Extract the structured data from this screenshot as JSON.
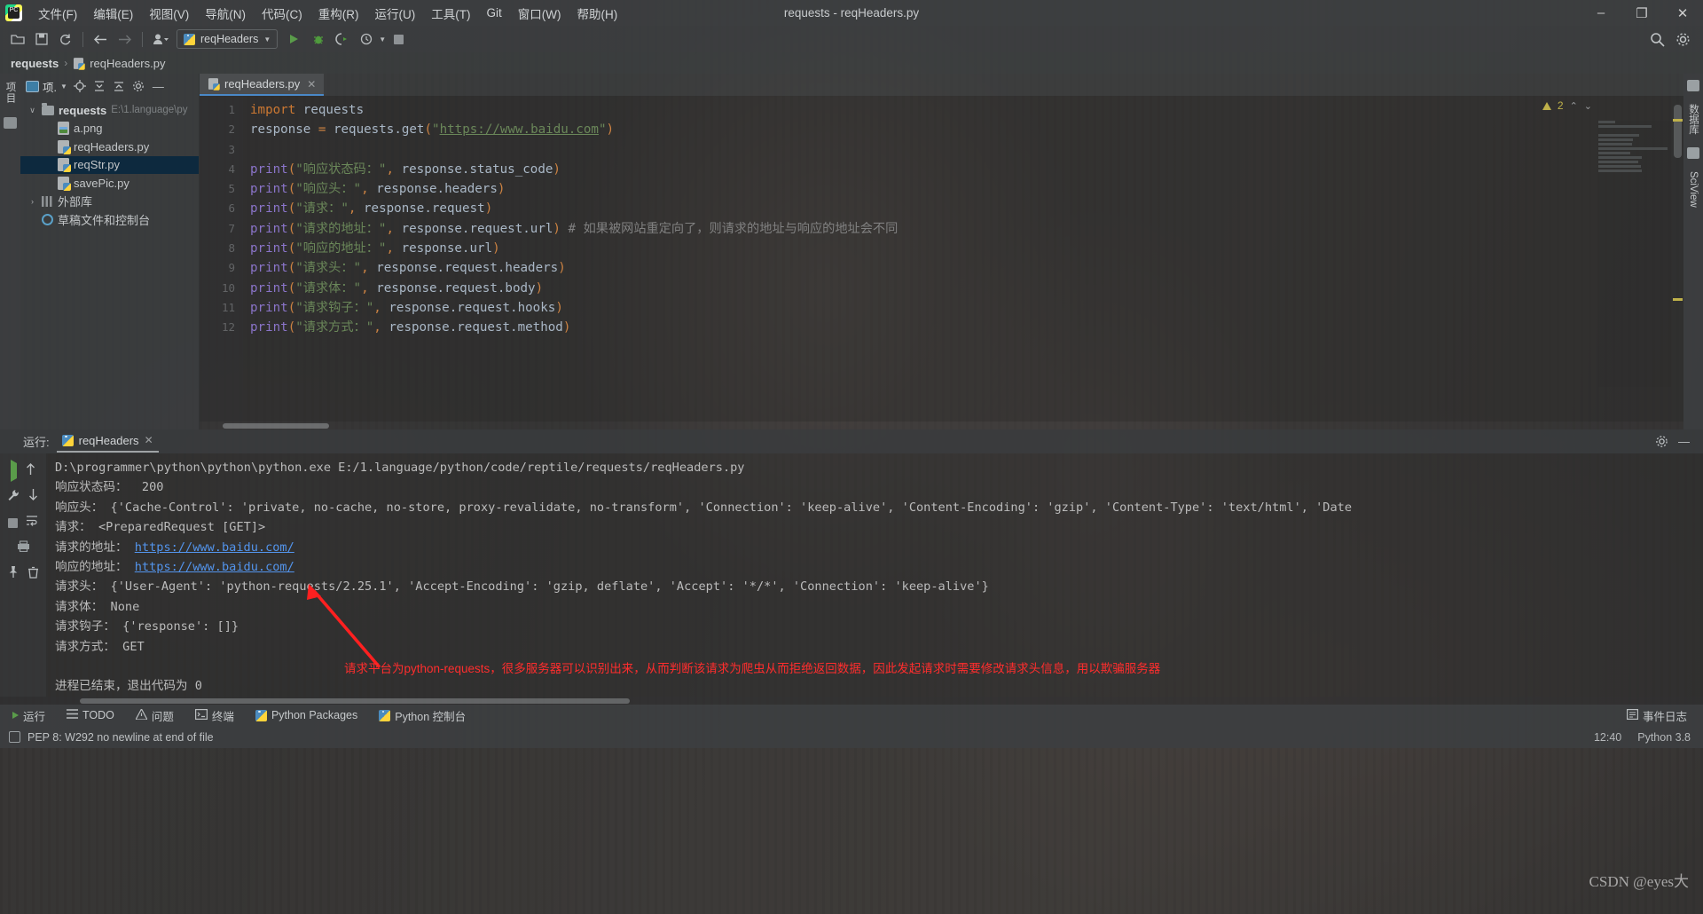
{
  "window": {
    "title": "requests - reqHeaders.py",
    "minimize": "–",
    "maximize": "❐",
    "close": "✕"
  },
  "menu": [
    {
      "label": "文件(F)"
    },
    {
      "label": "编辑(E)"
    },
    {
      "label": "视图(V)"
    },
    {
      "label": "导航(N)"
    },
    {
      "label": "代码(C)"
    },
    {
      "label": "重构(R)"
    },
    {
      "label": "运行(U)"
    },
    {
      "label": "工具(T)"
    },
    {
      "label": "Git"
    },
    {
      "label": "窗口(W)"
    },
    {
      "label": "帮助(H)"
    }
  ],
  "toolbar": {
    "open_icon": "open-folder-icon",
    "save_icon": "save-icon",
    "sync_icon": "sync-icon",
    "back_icon": "back-arrow-icon",
    "forward_icon": "forward-arrow-icon",
    "user_icon": "user-icon",
    "run_config": "reqHeaders",
    "run_icon": "run-icon",
    "debug_icon": "debug-icon",
    "coverage_icon": "run-coverage-icon",
    "profile_icon": "profile-icon",
    "stop_icon": "stop-icon",
    "search_icon": "search-icon",
    "settings_icon": "settings-gear-icon"
  },
  "breadcrumb": {
    "project": "requests",
    "separator": "›",
    "file": "reqHeaders.py"
  },
  "left_rail": {
    "project_label": "项目",
    "structure_icon": "structure-icon"
  },
  "project_panel": {
    "title": "项.",
    "locate_icon": "locate-target-icon",
    "expand_icon": "expand-all-icon",
    "collapse_icon": "collapse-all-icon",
    "settings_icon": "gear-icon",
    "hide_icon": "hide-icon",
    "tree": [
      {
        "label": "requests",
        "path": "E:\\1.language\\py",
        "kind": "folder",
        "depth": 0,
        "expanded": true,
        "selected": false
      },
      {
        "label": "a.png",
        "path": "",
        "kind": "image",
        "depth": 1,
        "expanded": false,
        "selected": false
      },
      {
        "label": "reqHeaders.py",
        "path": "",
        "kind": "python",
        "depth": 1,
        "expanded": false,
        "selected": false
      },
      {
        "label": "reqStr.py",
        "path": "",
        "kind": "python",
        "depth": 1,
        "expanded": false,
        "selected": true
      },
      {
        "label": "savePic.py",
        "path": "",
        "kind": "python",
        "depth": 1,
        "expanded": false,
        "selected": false
      },
      {
        "label": "外部库",
        "path": "",
        "kind": "library",
        "depth": 0,
        "expanded": false,
        "selected": false
      },
      {
        "label": "草稿文件和控制台",
        "path": "",
        "kind": "console",
        "depth": 0,
        "expanded": false,
        "selected": false
      }
    ]
  },
  "editor": {
    "tab": {
      "name": "reqHeaders.py",
      "close": "✕"
    },
    "warning_count": "2",
    "chevron_up": "⌃",
    "chevron_down": "⌄",
    "lines": [
      {
        "n": "1",
        "tokens": [
          {
            "t": "import",
            "c": "kw"
          },
          {
            "t": " requests",
            "c": "var"
          }
        ]
      },
      {
        "n": "2",
        "tokens": [
          {
            "t": "response ",
            "c": "var"
          },
          {
            "t": "= ",
            "c": "par"
          },
          {
            "t": "requests",
            "c": "var"
          },
          {
            "t": ".get",
            "c": "var"
          },
          {
            "t": "(",
            "c": "par"
          },
          {
            "t": "\"",
            "c": "str"
          },
          {
            "t": "https://www.baidu.com",
            "c": "link"
          },
          {
            "t": "\"",
            "c": "str"
          },
          {
            "t": ")",
            "c": "par"
          }
        ]
      },
      {
        "n": "3",
        "tokens": []
      },
      {
        "n": "4",
        "tokens": [
          {
            "t": "print",
            "c": "fn"
          },
          {
            "t": "(",
            "c": "par"
          },
          {
            "t": "\"响应状态码：\"",
            "c": "str"
          },
          {
            "t": ", ",
            "c": "par"
          },
          {
            "t": "response.status_code",
            "c": "var"
          },
          {
            "t": ")",
            "c": "par"
          }
        ]
      },
      {
        "n": "5",
        "tokens": [
          {
            "t": "print",
            "c": "fn"
          },
          {
            "t": "(",
            "c": "par"
          },
          {
            "t": "\"响应头：\"",
            "c": "str"
          },
          {
            "t": ", ",
            "c": "par"
          },
          {
            "t": "response.headers",
            "c": "var"
          },
          {
            "t": ")",
            "c": "par"
          }
        ]
      },
      {
        "n": "6",
        "tokens": [
          {
            "t": "print",
            "c": "fn"
          },
          {
            "t": "(",
            "c": "par"
          },
          {
            "t": "\"请求：\"",
            "c": "str"
          },
          {
            "t": ", ",
            "c": "par"
          },
          {
            "t": "response.request",
            "c": "var"
          },
          {
            "t": ")",
            "c": "par"
          }
        ]
      },
      {
        "n": "7",
        "tokens": [
          {
            "t": "print",
            "c": "fn"
          },
          {
            "t": "(",
            "c": "par"
          },
          {
            "t": "\"请求的地址：\"",
            "c": "str"
          },
          {
            "t": ", ",
            "c": "par"
          },
          {
            "t": "response.request.url",
            "c": "var"
          },
          {
            "t": ")",
            "c": "par"
          },
          {
            "t": " # 如果被网站重定向了，则请求的地址与响应的地址会不同",
            "c": "cmt"
          }
        ]
      },
      {
        "n": "8",
        "tokens": [
          {
            "t": "print",
            "c": "fn"
          },
          {
            "t": "(",
            "c": "par"
          },
          {
            "t": "\"响应的地址：\"",
            "c": "str"
          },
          {
            "t": ", ",
            "c": "par"
          },
          {
            "t": "response.url",
            "c": "var"
          },
          {
            "t": ")",
            "c": "par"
          }
        ]
      },
      {
        "n": "9",
        "tokens": [
          {
            "t": "print",
            "c": "fn"
          },
          {
            "t": "(",
            "c": "par"
          },
          {
            "t": "\"请求头：\"",
            "c": "str"
          },
          {
            "t": ", ",
            "c": "par"
          },
          {
            "t": "response.request.headers",
            "c": "var"
          },
          {
            "t": ")",
            "c": "par"
          }
        ]
      },
      {
        "n": "10",
        "tokens": [
          {
            "t": "print",
            "c": "fn"
          },
          {
            "t": "(",
            "c": "par"
          },
          {
            "t": "\"请求体：\"",
            "c": "str"
          },
          {
            "t": ", ",
            "c": "par"
          },
          {
            "t": "response.request.body",
            "c": "var"
          },
          {
            "t": ")",
            "c": "par"
          }
        ]
      },
      {
        "n": "11",
        "tokens": [
          {
            "t": "print",
            "c": "fn"
          },
          {
            "t": "(",
            "c": "par"
          },
          {
            "t": "\"请求钩子：\"",
            "c": "str"
          },
          {
            "t": ", ",
            "c": "par"
          },
          {
            "t": "response.request.hooks",
            "c": "var"
          },
          {
            "t": ")",
            "c": "par"
          }
        ]
      },
      {
        "n": "12",
        "tokens": [
          {
            "t": "print",
            "c": "fn"
          },
          {
            "t": "(",
            "c": "par"
          },
          {
            "t": "\"请求方式：\"",
            "c": "str"
          },
          {
            "t": ", ",
            "c": "par"
          },
          {
            "t": "response.request.method",
            "c": "var"
          },
          {
            "t": ")",
            "c": "par"
          }
        ]
      }
    ]
  },
  "right_rail": {
    "db_label": "数据库",
    "sciview_label": "SciView",
    "notif_icon": "notifications-icon"
  },
  "run_panel": {
    "label": "运行:",
    "tab": "reqHeaders",
    "tab_close": "✕",
    "settings_icon": "gear-icon",
    "hide_icon": "hide-icon",
    "rerun_icon": "rerun-icon",
    "scroll_up_icon": "scroll-up-icon",
    "wrench_icon": "wrench-icon",
    "scroll_down_icon": "scroll-down-icon",
    "stop_icon": "stop-icon",
    "soft_wrap_icon": "soft-wrap-icon",
    "print_icon": "print-icon",
    "pin_icon": "pin-icon",
    "trash_icon": "trash-icon",
    "output": [
      {
        "type": "text",
        "text": "D:\\programmer\\python\\python\\python.exe E:/1.language/python/code/reptile/requests/reqHeaders.py"
      },
      {
        "type": "text",
        "text": "响应状态码：  200"
      },
      {
        "type": "text",
        "text": "响应头： {'Cache-Control': 'private, no-cache, no-store, proxy-revalidate, no-transform', 'Connection': 'keep-alive', 'Content-Encoding': 'gzip', 'Content-Type': 'text/html', 'Date"
      },
      {
        "type": "text",
        "text": "请求： <PreparedRequest [GET]>"
      },
      {
        "type": "link",
        "prefix": "请求的地址： ",
        "text": "https://www.baidu.com/"
      },
      {
        "type": "link",
        "prefix": "响应的地址： ",
        "text": "https://www.baidu.com/"
      },
      {
        "type": "text",
        "text": "请求头： {'User-Agent': 'python-requests/2.25.1', 'Accept-Encoding': 'gzip, deflate', 'Accept': '*/*', 'Connection': 'keep-alive'}"
      },
      {
        "type": "text",
        "text": "请求体： None"
      },
      {
        "type": "text",
        "text": "请求钩子： {'response': []}"
      },
      {
        "type": "text",
        "text": "请求方式： GET"
      },
      {
        "type": "blank",
        "text": ""
      },
      {
        "type": "text",
        "text": "进程已结束，退出代码为 0"
      }
    ]
  },
  "annotation": {
    "text": "请求平台为python-requests，很多服务器可以识别出来，从而判断该请求为爬虫从而拒绝返回数据，因此发起请求时需要修改请求头信息，用以欺骗服务器",
    "color": "#ff2d2d",
    "arrow": "red-arrow-annotation"
  },
  "tool_windows": [
    {
      "label": "运行",
      "icon": "run-icon"
    },
    {
      "label": "TODO",
      "icon": "todo-icon"
    },
    {
      "label": "问题",
      "icon": "problems-icon"
    },
    {
      "label": "终端",
      "icon": "terminal-icon"
    },
    {
      "label": "Python Packages",
      "icon": "packages-icon"
    },
    {
      "label": "Python 控制台",
      "icon": "python-console-icon"
    }
  ],
  "tool_windows_right": {
    "event_log": "事件日志",
    "event_icon": "event-log-icon"
  },
  "status_bar": {
    "message": "PEP 8: W292 no newline at end of file",
    "icon": "inspection-icon",
    "time": "12:40",
    "interpreter": "Python 3.8"
  },
  "watermark": "CSDN @eyes大"
}
